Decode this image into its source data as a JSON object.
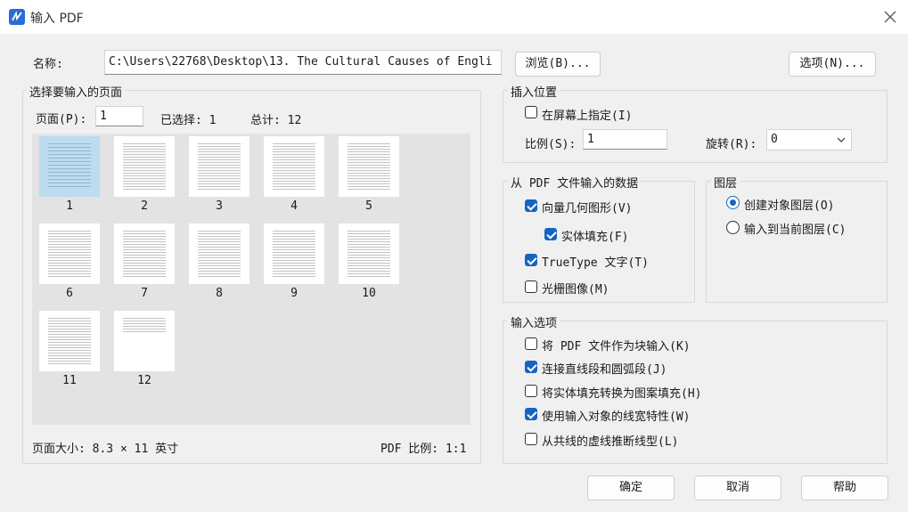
{
  "window": {
    "title": "输入 PDF"
  },
  "name_row": {
    "label": "名称:",
    "path": "C:\\Users\\22768\\Desktop\\13. The Cultural Causes of Engli",
    "browse_label": "浏览(B)...",
    "options_label": "选项(N)..."
  },
  "pages": {
    "group_title": "选择要输入的页面",
    "page_label": "页面(P):",
    "page_value": "1",
    "selected_label": "已选择: 1",
    "total_label": "总计: 12",
    "thumbnails": [
      "1",
      "2",
      "3",
      "4",
      "5",
      "6",
      "7",
      "8",
      "9",
      "10",
      "11",
      "12"
    ],
    "selected_page": "1",
    "page_size": "页面大小: 8.3 × 11 英寸",
    "pdf_scale": "PDF 比例: 1:1"
  },
  "insert_point": {
    "group_title": "插入位置",
    "on_screen_label": "在屏幕上指定(I)",
    "on_screen_checked": false,
    "scale_label": "比例(S):",
    "scale_value": "1",
    "rotation_label": "旋转(R):",
    "rotation_value": "0"
  },
  "import_data": {
    "group_title": "从 PDF 文件输入的数据",
    "vector_label": "向量几何图形(V)",
    "vector_checked": true,
    "solid_fill_label": "实体填充(F)",
    "solid_fill_checked": true,
    "truetype_label": "TrueType 文字(T)",
    "truetype_checked": true,
    "raster_label": "光栅图像(M)",
    "raster_checked": false
  },
  "layers": {
    "group_title": "图层",
    "create_label": "创建对象图层(O)",
    "create_selected": true,
    "current_label": "输入到当前图层(C)",
    "current_selected": false
  },
  "import_options": {
    "group_title": "输入选项",
    "block_label": "将 PDF 文件作为块输入(K)",
    "block_checked": false,
    "join_label": "连接直线段和圆弧段(J)",
    "join_checked": true,
    "hatch_label": "将实体填充转换为图案填充(H)",
    "hatch_checked": false,
    "lineweight_label": "使用输入对象的线宽特性(W)",
    "lineweight_checked": true,
    "infer_label": "从共线的虚线推断线型(L)",
    "infer_checked": false
  },
  "footer": {
    "ok_label": "确定",
    "cancel_label": "取消",
    "help_label": "帮助"
  },
  "colors": {
    "accent": "#1565c0",
    "selected_thumb": "#bcdcef",
    "app_icon": "#2b6cd8"
  }
}
